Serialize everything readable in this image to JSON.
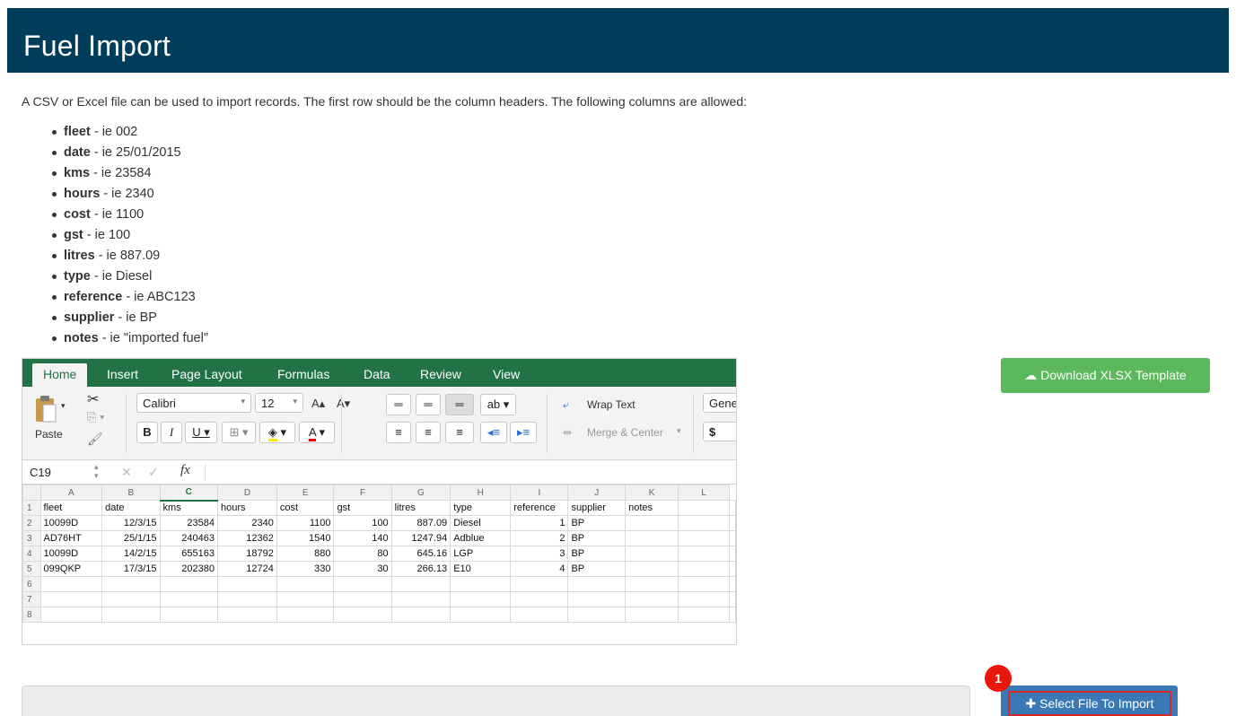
{
  "header": {
    "title": "Fuel Import"
  },
  "intro": "A CSV or Excel file can be used to import records. The first row should be the column headers. The following columns are allowed:",
  "columns": [
    {
      "name": "fleet",
      "example": " - ie 002"
    },
    {
      "name": "date",
      "example": " - ie 25/01/2015"
    },
    {
      "name": "kms",
      "example": " - ie 23584"
    },
    {
      "name": "hours",
      "example": " - ie 2340"
    },
    {
      "name": "cost",
      "example": " - ie 1100"
    },
    {
      "name": "gst",
      "example": " - ie 100"
    },
    {
      "name": "litres",
      "example": " - ie 887.09"
    },
    {
      "name": "type",
      "example": " - ie Diesel"
    },
    {
      "name": "reference",
      "example": " - ie ABC123"
    },
    {
      "name": "supplier",
      "example": " - ie BP"
    },
    {
      "name": "notes",
      "example": " - ie \"imported fuel\""
    }
  ],
  "excel": {
    "tabs": [
      "Home",
      "Insert",
      "Page Layout",
      "Formulas",
      "Data",
      "Review",
      "View"
    ],
    "paste_label": "Paste",
    "font_name": "Calibri",
    "font_size": "12",
    "wrap_text": "Wrap Text",
    "merge_center": "Merge & Center",
    "number_format": "Gene",
    "currency": "$",
    "cell_ref": "C19",
    "fx": "fx",
    "col_letters": [
      "A",
      "B",
      "C",
      "D",
      "E",
      "F",
      "G",
      "H",
      "I",
      "J",
      "K",
      "L"
    ],
    "rows": [
      [
        "fleet",
        "date",
        "kms",
        "hours",
        "cost",
        "gst",
        "litres",
        "type",
        "reference",
        "supplier",
        "notes",
        ""
      ],
      [
        "10099D",
        "12/3/15",
        "23584",
        "2340",
        "1100",
        "100",
        "887.09",
        "Diesel",
        "1",
        "BP",
        "",
        ""
      ],
      [
        "AD76HT",
        "25/1/15",
        "240463",
        "12362",
        "1540",
        "140",
        "1247.94",
        "Adblue",
        "2",
        "BP",
        "",
        ""
      ],
      [
        "10099D",
        "14/2/15",
        "655163",
        "18792",
        "880",
        "80",
        "645.16",
        "LGP",
        "3",
        "BP",
        "",
        ""
      ],
      [
        "099QKP",
        "17/3/15",
        "202380",
        "12724",
        "330",
        "30",
        "266.13",
        "E10",
        "4",
        "BP",
        "",
        ""
      ],
      [
        "",
        "",
        "",
        "",
        "",
        "",
        "",
        "",
        "",
        "",
        "",
        ""
      ],
      [
        "",
        "",
        "",
        "",
        "",
        "",
        "",
        "",
        "",
        "",
        "",
        ""
      ],
      [
        "",
        "",
        "",
        "",
        "",
        "",
        "",
        "",
        "",
        "",
        "",
        ""
      ]
    ]
  },
  "buttons": {
    "download_template": "Download XLSX Template",
    "select_file": "Select File To Import"
  },
  "badge": "1",
  "colors": {
    "header_bg": "#003d5b",
    "excel_green": "#217346",
    "download_green": "#5cb85c",
    "select_blue": "#3a79b5",
    "badge_red": "#e8170b"
  }
}
